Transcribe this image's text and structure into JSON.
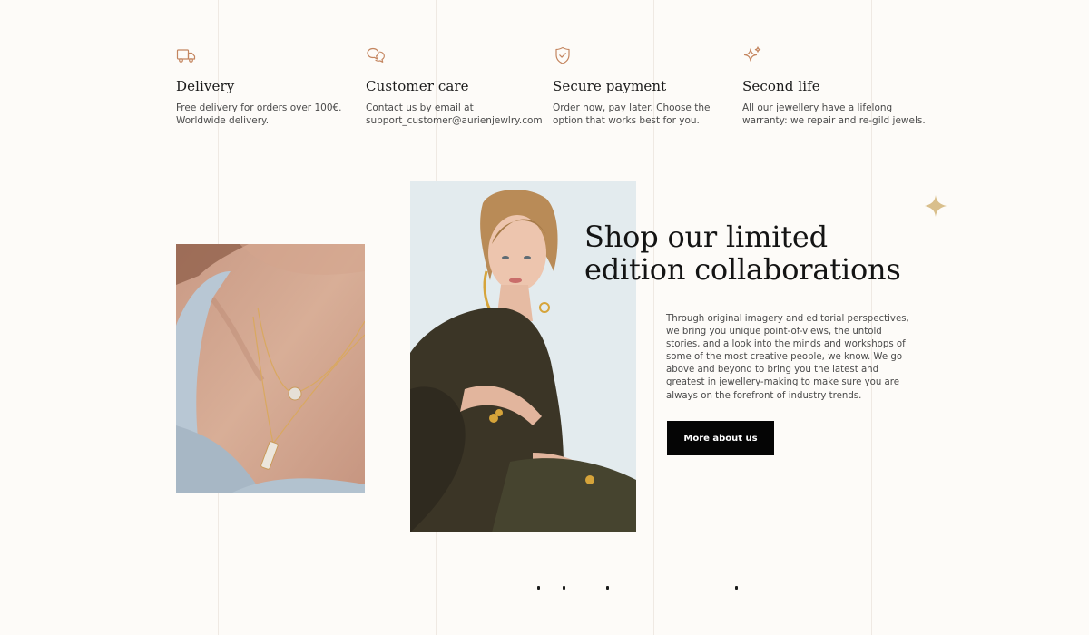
{
  "features": [
    {
      "icon": "truck-icon",
      "title": "Delivery",
      "description": "Free delivery for orders over 100€.\nWorldwide delivery."
    },
    {
      "icon": "chat-bubbles-icon",
      "title": "Customer care",
      "description": "Contact us by email at\nsupport_customer@aurienjewlry.com"
    },
    {
      "icon": "shield-check-icon",
      "title": "Secure payment",
      "description": "Order now, pay later. Choose the\noption that works best for you."
    },
    {
      "icon": "sparkle-icon",
      "title": "Second life",
      "description": "All our jewellery have a lifelong\nwarranty: we repair and re-gild jewels."
    }
  ],
  "collab": {
    "headline_line1": "Shop our limited",
    "headline_line2": "edition collaborations",
    "body": "Through original imagery and editorial perspectives, we bring you unique point-of-views, the untold stories, and a look into the minds and workshops of some of the most creative people, we know. We go above and beyond to bring you the latest and greatest in jewellery-making to make sure you are always on the forefront of industry trends.",
    "cta_label": "More about us"
  },
  "colors": {
    "background": "#fdfbf8",
    "accent": "#c4855f",
    "gold": "#d9bf8c",
    "button": "#050505"
  },
  "images": {
    "necklace_photo": "necklace-closeup-photo",
    "model_photo": "model-with-gold-jewellery-photo"
  }
}
